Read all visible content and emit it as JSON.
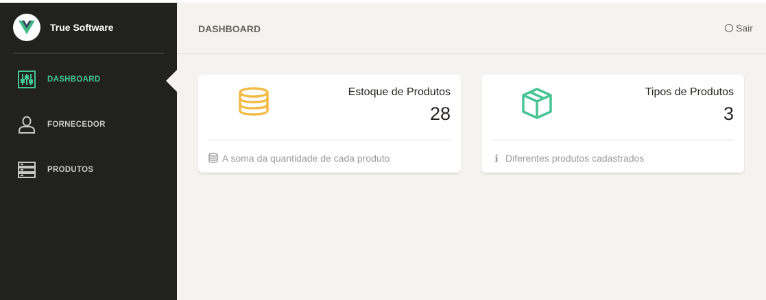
{
  "app": {
    "name": "True Software",
    "logo_icon": "vue-logo-icon"
  },
  "sidebar": {
    "items": [
      {
        "label": "DASHBOARD",
        "icon": "sliders-icon",
        "active": true
      },
      {
        "label": "FORNECEDOR",
        "icon": "user-icon",
        "active": false
      },
      {
        "label": "PRODUTOS",
        "icon": "server-list-icon",
        "active": false
      }
    ]
  },
  "header": {
    "title": "DASHBOARD",
    "logout_label": "Sair",
    "logout_icon": "circle-icon"
  },
  "cards": [
    {
      "title": "Estoque de Produtos",
      "value": "28",
      "icon": "database-icon",
      "icon_color": "#f3bb45",
      "footer_text": "A soma da quantidade de cada produto",
      "footer_icon": "database-icon"
    },
    {
      "title": "Tipos de Produtos",
      "value": "3",
      "icon": "package-box-icon",
      "icon_color": "#45c494",
      "footer_text": "Diferentes produtos cadastrados",
      "footer_icon": "info-icon"
    }
  ],
  "colors": {
    "sidebar_bg": "#212120",
    "accent_green": "#45c494",
    "accent_yellow": "#f3bb45",
    "page_bg": "#f4f3ef"
  }
}
